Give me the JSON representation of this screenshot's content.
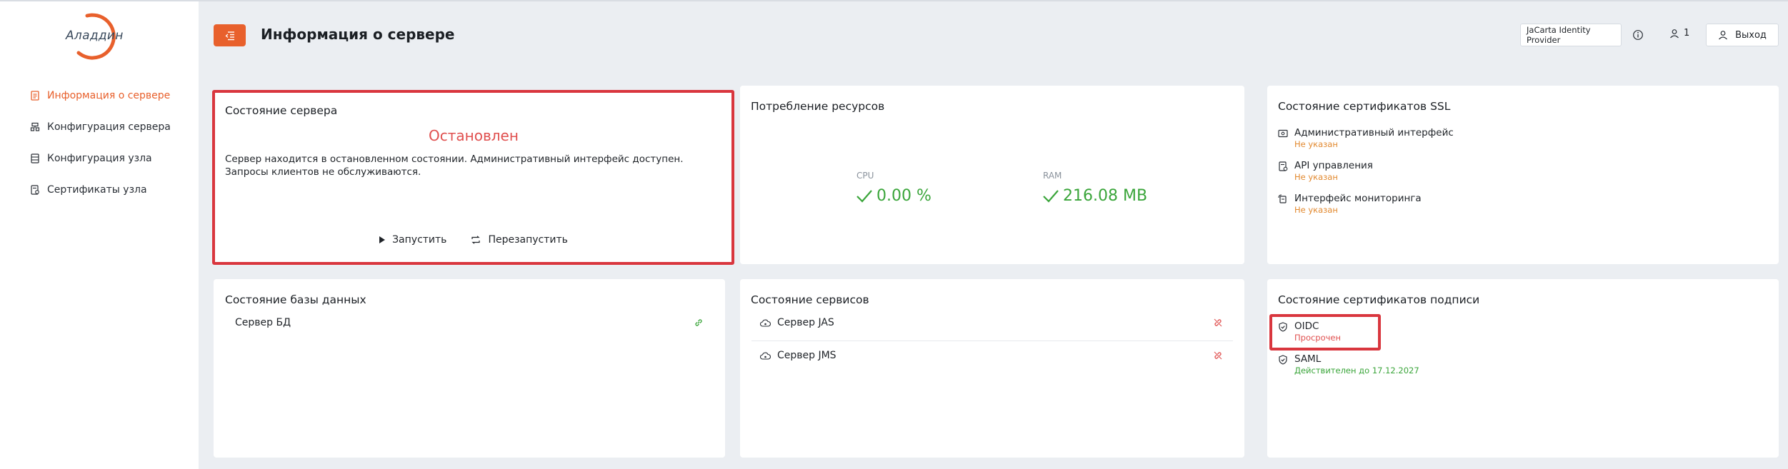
{
  "brand": {
    "logo_text": "Аладдин"
  },
  "nav": [
    {
      "label": "Информация о сервере",
      "icon": "document-info-icon",
      "active": true
    },
    {
      "label": "Конфигурация сервера",
      "icon": "server-config-icon",
      "active": false
    },
    {
      "label": "Конфигурация узла",
      "icon": "node-config-icon",
      "active": false
    },
    {
      "label": "Сертификаты узла",
      "icon": "node-certificate-icon",
      "active": false
    }
  ],
  "header": {
    "menu_icon": "menu-icon",
    "title": "Информация о сервере",
    "provider": "JaCarta Identity Provider",
    "user_count": "1",
    "logout_label": "Выход"
  },
  "server_state": {
    "title": "Состояние сервера",
    "status": "Остановлен",
    "description": "Сервер находится в остановленном состоянии. Административный интерфейс доступен. Запросы клиентов не обслуживаются.",
    "start_label": "Запустить",
    "restart_label": "Перезапустить"
  },
  "resources": {
    "title": "Потребление ресурсов",
    "cpu_label": "CPU",
    "cpu_value": "0.00 %",
    "ram_label": "RAM",
    "ram_value": "216.08 MB"
  },
  "ssl_certs": {
    "title": "Состояние сертификатов SSL",
    "items": [
      {
        "name": "Административный интерфейс",
        "status": "Не указан",
        "icon": "admin-interface-icon"
      },
      {
        "name": "API управления",
        "status": "Не указан",
        "icon": "api-icon"
      },
      {
        "name": "Интерфейс мониторинга",
        "status": "Не указан",
        "icon": "monitoring-icon"
      }
    ]
  },
  "database": {
    "title": "Состояние базы данных",
    "items": [
      {
        "name": "Сервер БД",
        "state_icon": "link-connected-icon"
      }
    ]
  },
  "services": {
    "title": "Состояние сервисов",
    "items": [
      {
        "name": "Сервер JAS",
        "state_icon": "link-broken-icon"
      },
      {
        "name": "Сервер JMS",
        "state_icon": "link-broken-icon"
      }
    ]
  },
  "signing_certs": {
    "title": "Состояние сертификатов подписи",
    "items": [
      {
        "name": "OIDC",
        "status": "Просрочен",
        "icon": "shield-check-icon"
      },
      {
        "name": "SAML",
        "status": "Действителен до 17.12.2027",
        "icon": "shield-check-icon"
      }
    ]
  },
  "colors": {
    "accent": "#e8602c",
    "success": "#3aa53a",
    "error": "#e0504f",
    "warning": "#e2892f",
    "highlight": "#d9363e",
    "background": "#ebeef2"
  }
}
